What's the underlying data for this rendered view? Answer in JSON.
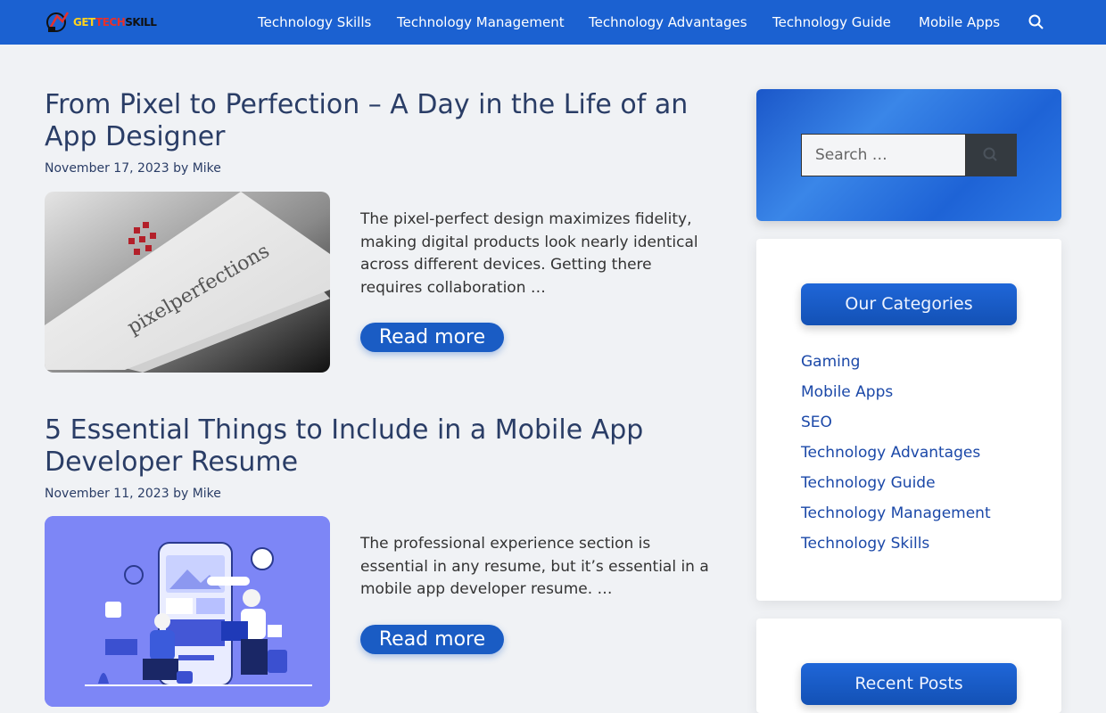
{
  "header": {
    "logo_text_1": "GET",
    "logo_text_2": "TECH",
    "logo_text_3": "SKILL",
    "nav": [
      "Technology Skills",
      "Technology Management",
      "Technology Advantages",
      "Technology Guide",
      "Mobile Apps"
    ]
  },
  "posts": [
    {
      "title": "From Pixel to Perfection – A Day in the Life of an App Designer",
      "date": "November 17, 2023",
      "by": "by",
      "author": "Mike",
      "image_text": "pixelperfections",
      "excerpt": "The pixel-perfect design maximizes fidelity, making digital products look nearly identical across different devices. Getting there requires collaboration …",
      "read_more": "Read more"
    },
    {
      "title": "5 Essential Things to Include in a Mobile App Developer Resume",
      "date": "November 11, 2023",
      "by": "by",
      "author": "Mike",
      "excerpt": "The professional experience section is essential in any resume, but it’s essential in a mobile app developer resume. …",
      "read_more": "Read more"
    }
  ],
  "sidebar": {
    "search_placeholder": "Search …",
    "categories_title": "Our Categories",
    "categories": [
      "Gaming",
      "Mobile Apps",
      "SEO",
      "Technology Advantages",
      "Technology Guide",
      "Technology Management",
      "Technology Skills"
    ],
    "recent_title": "Recent Posts"
  },
  "colors": {
    "accent": "#1b61d1",
    "title": "#2a3d66"
  },
  "icons": {
    "search": "search-icon"
  }
}
